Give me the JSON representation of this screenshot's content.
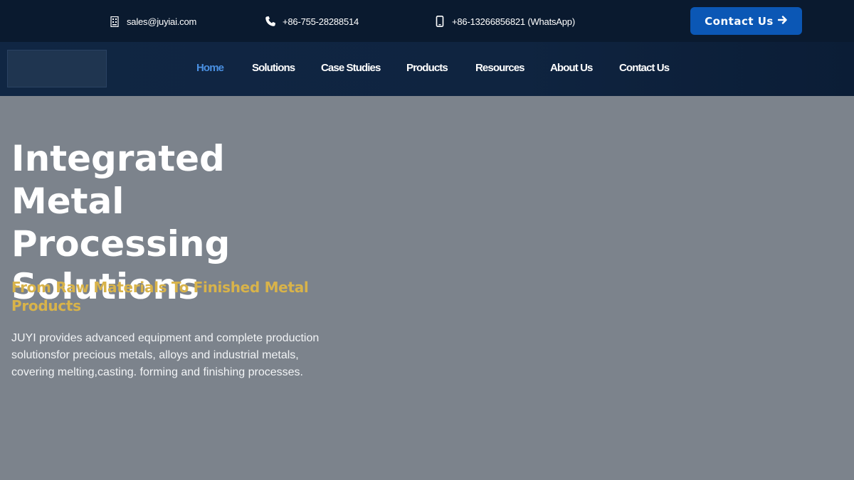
{
  "topbar": {
    "email": "sales@juyiai.com",
    "phone": "+86-755-28288514",
    "whatsapp": "+86-13266856821 (WhatsApp)",
    "contact_button": "Contact Us"
  },
  "nav": {
    "items": [
      {
        "label": "Home",
        "active": true
      },
      {
        "label": "Solutions"
      },
      {
        "label": "Case Studies"
      },
      {
        "label": "Products"
      },
      {
        "label": "Resources"
      },
      {
        "label": "About Us"
      },
      {
        "label": "Contact Us"
      }
    ]
  },
  "hero": {
    "title": "Integrated Metal Processing Solutions",
    "subtitle": "From Raw Materials To Finished Metal Products",
    "description": "JUYI provides advanced equipment and complete production solutionsfor precious metals, alloys and industrial metals, covering melting,casting. forming and finishing processes."
  },
  "colors": {
    "topbar_bg": "#0a1a2f",
    "navbar_bg": "#102643",
    "accent_blue": "#0b57b5",
    "active_nav": "#4a90e2",
    "subtitle_gold": "#d8b34a",
    "hero_bg": "#7c838c"
  },
  "icons": {
    "email": "email-icon",
    "phone": "phone-icon",
    "mobile": "mobile-phone-icon",
    "button_arrow": "arrow-right-icon"
  }
}
